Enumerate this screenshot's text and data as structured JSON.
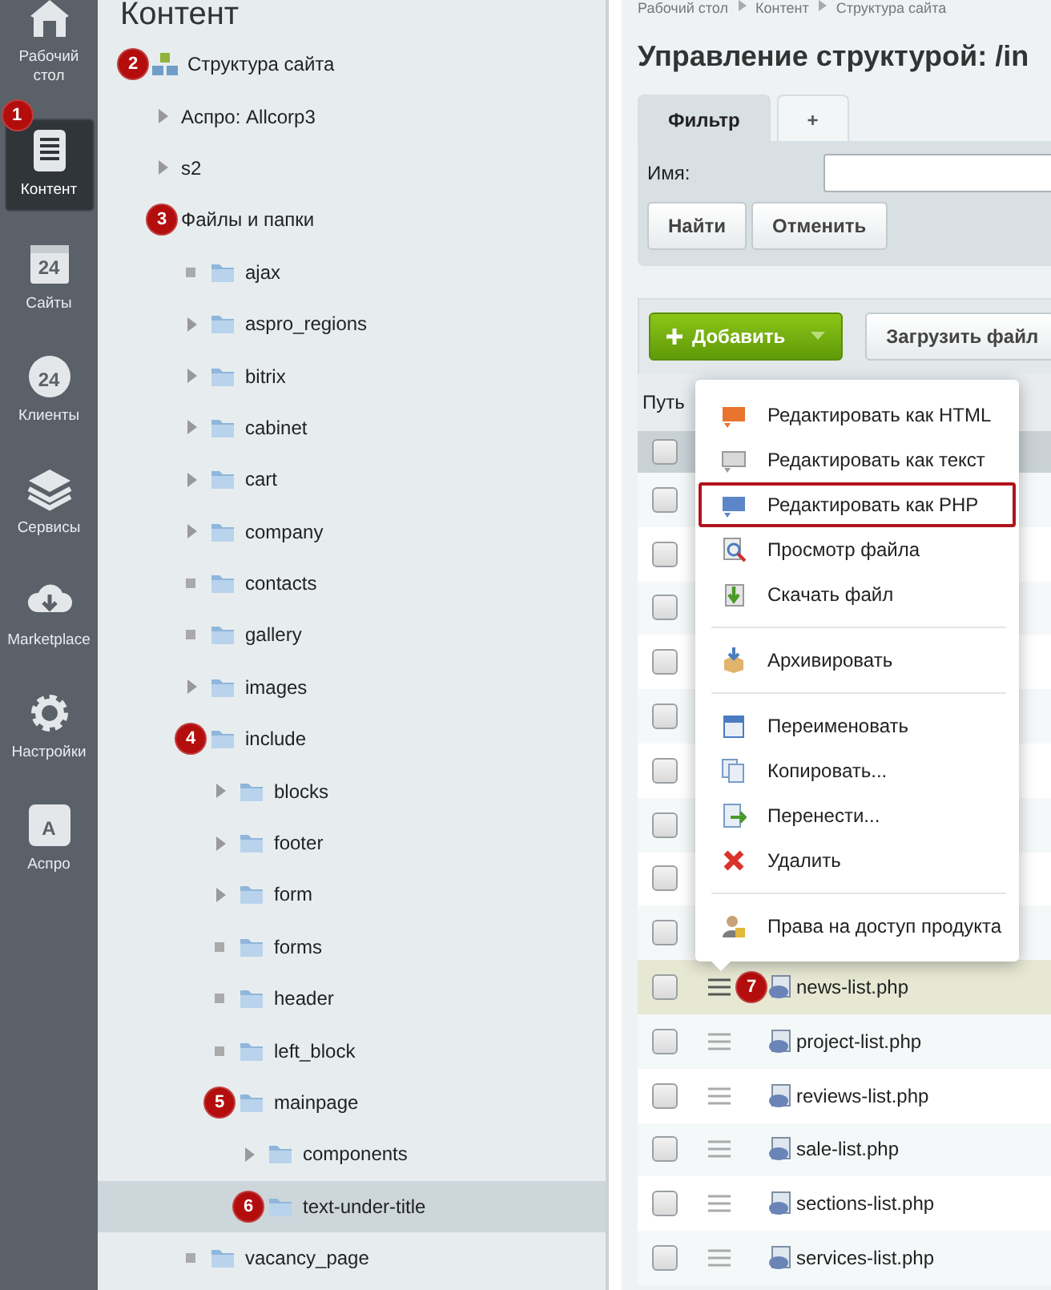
{
  "sidebar": {
    "items": [
      {
        "label": "Рабочий стол",
        "selected": false
      },
      {
        "label": "Контент",
        "selected": true,
        "badge": "1"
      },
      {
        "label": "Сайты",
        "glyph": "24",
        "selected": false
      },
      {
        "label": "Клиенты",
        "glyph": "24",
        "selected": false
      },
      {
        "label": "Сервисы",
        "selected": false
      },
      {
        "label": "Marketplace",
        "selected": false
      },
      {
        "label": "Настройки",
        "selected": false
      },
      {
        "label": "Аспро",
        "glyph": "A",
        "selected": false
      }
    ]
  },
  "tree": {
    "title": "Контент",
    "items": [
      {
        "kind": "structure",
        "label": "Структура сайта",
        "badge": "2",
        "selected": false,
        "children": [
          {
            "label": "Аспро: Allcorp3",
            "expanded": false,
            "selected": false
          },
          {
            "label": "s2",
            "expanded": false,
            "selected": false
          },
          {
            "label": "Файлы и папки",
            "badge": "3",
            "selected": false,
            "children": [
              {
                "kind": "folder",
                "label": "ajax",
                "selected": false
              },
              {
                "kind": "folder",
                "label": "aspro_regions",
                "expanded": false,
                "selected": false
              },
              {
                "kind": "folder",
                "label": "bitrix",
                "expanded": false,
                "selected": false
              },
              {
                "kind": "folder",
                "label": "cabinet",
                "expanded": false,
                "selected": false
              },
              {
                "kind": "folder",
                "label": "cart",
                "expanded": false,
                "selected": false
              },
              {
                "kind": "folder",
                "label": "company",
                "expanded": false,
                "selected": false
              },
              {
                "kind": "folder",
                "label": "contacts",
                "selected": false
              },
              {
                "kind": "folder",
                "label": "gallery",
                "selected": false
              },
              {
                "kind": "folder",
                "label": "images",
                "expanded": false,
                "selected": false
              },
              {
                "kind": "folder",
                "label": "include",
                "badge": "4",
                "selected": false,
                "children": [
                  {
                    "kind": "folder",
                    "label": "blocks",
                    "expanded": false,
                    "selected": false
                  },
                  {
                    "kind": "folder",
                    "label": "footer",
                    "expanded": false,
                    "selected": false
                  },
                  {
                    "kind": "folder",
                    "label": "form",
                    "expanded": false,
                    "selected": false
                  },
                  {
                    "kind": "folder",
                    "label": "forms",
                    "selected": false
                  },
                  {
                    "kind": "folder",
                    "label": "header",
                    "selected": false
                  },
                  {
                    "kind": "folder",
                    "label": "left_block",
                    "selected": false
                  },
                  {
                    "kind": "folder",
                    "label": "mainpage",
                    "badge": "5",
                    "selected": false,
                    "children": [
                      {
                        "kind": "folder",
                        "label": "components",
                        "expanded": false,
                        "selected": false
                      },
                      {
                        "kind": "folder",
                        "label": "text-under-title",
                        "badge": "6",
                        "selected": true
                      }
                    ]
                  }
                ]
              },
              {
                "kind": "folder",
                "label": "vacancy_page",
                "selected": false
              }
            ]
          }
        ]
      }
    ]
  },
  "breadcrumbs": [
    "Рабочий стол",
    "Контент",
    "Структура сайта"
  ],
  "title": "Управление структурой: /in",
  "filter": {
    "tabs": [
      {
        "label": "Фильтр",
        "selected": true
      },
      {
        "label": "+",
        "selected": false
      }
    ],
    "field_label": "Имя:",
    "buttons": [
      "Найти",
      "Отменить"
    ]
  },
  "toolbar": {
    "add_button": "Добавить",
    "upload_button": "Загрузить файл"
  },
  "path_label": "Путь",
  "table": {
    "header_checked": false,
    "rows": [
      {
        "checked": false
      },
      {
        "checked": false
      },
      {
        "checked": false
      },
      {
        "checked": false
      },
      {
        "checked": false
      },
      {
        "checked": false
      },
      {
        "checked": false
      },
      {
        "checked": false
      },
      {
        "checked": false
      },
      {
        "name": "news-list.php",
        "checked": false,
        "selected": true,
        "badge": "7"
      },
      {
        "name": "project-list.php",
        "checked": false,
        "selected": false
      },
      {
        "name": "reviews-list.php",
        "checked": false,
        "selected": false
      },
      {
        "name": "sale-list.php",
        "checked": false,
        "selected": false
      },
      {
        "name": "sections-list.php",
        "checked": false,
        "selected": false
      },
      {
        "name": "services-list.php",
        "checked": false,
        "selected": false
      }
    ]
  },
  "context_menu": {
    "items": [
      {
        "kind": "item",
        "label": "Редактировать как HTML",
        "highlighted": false
      },
      {
        "kind": "item",
        "label": "Редактировать как текст",
        "highlighted": false
      },
      {
        "kind": "item",
        "label": "Редактировать как PHP",
        "highlighted": true
      },
      {
        "kind": "item",
        "label": "Просмотр файла",
        "highlighted": false
      },
      {
        "kind": "item",
        "label": "Скачать файл",
        "highlighted": false
      },
      {
        "kind": "separator"
      },
      {
        "kind": "item",
        "label": "Архивировать",
        "highlighted": false
      },
      {
        "kind": "separator"
      },
      {
        "kind": "item",
        "label": "Переименовать",
        "highlighted": false
      },
      {
        "kind": "item",
        "label": "Копировать...",
        "highlighted": false
      },
      {
        "kind": "item",
        "label": "Перенести...",
        "highlighted": false
      },
      {
        "kind": "item",
        "label": "Удалить",
        "highlighted": false
      },
      {
        "kind": "separator"
      },
      {
        "kind": "item",
        "label": "Права на доступ продукта",
        "highlighted": false
      }
    ]
  }
}
